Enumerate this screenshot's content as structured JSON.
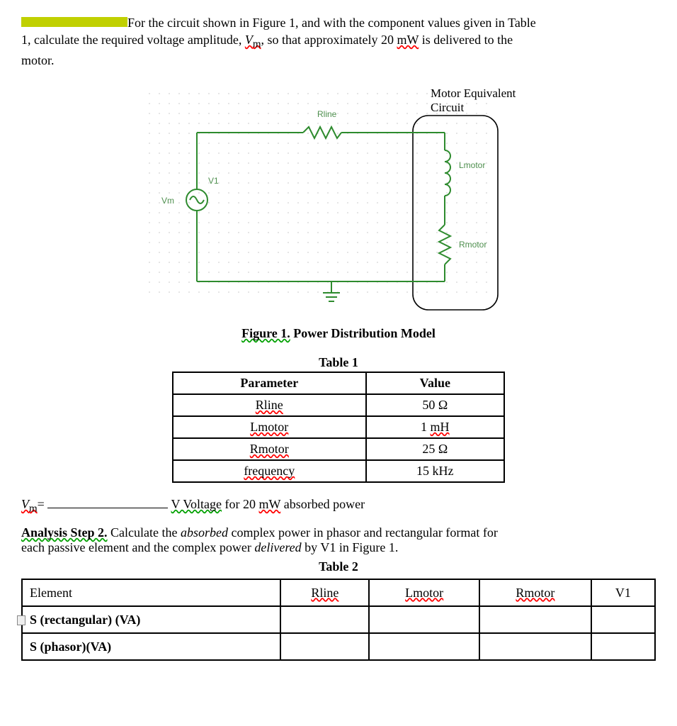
{
  "problem": {
    "lead1a": "For the circuit shown in Figure 1, and with the component values given in Table",
    "lead1b": "1, calculate the required voltage amplitude, ",
    "vm_label": "V",
    "vm_sub": "m",
    "lead1c": ", so that approximately 20 ",
    "mW": "mW",
    "lead1d": " is delivered to the",
    "lead1e": "motor."
  },
  "figure": {
    "title_motor": "Motor Equivalent",
    "title_circuit": "Circuit",
    "rline": "Rline",
    "vm": "Vm",
    "v1": "V1",
    "lmotor": "Lmotor",
    "rmotor": "Rmotor",
    "caption_prefix": "Figure 1.",
    "caption_text": " Power Distribution Model"
  },
  "table1": {
    "caption": "Table 1",
    "headers": [
      "Parameter",
      "Value"
    ],
    "rows": [
      {
        "param": "Rline",
        "value": "50 Ω"
      },
      {
        "param": "Lmotor",
        "value": "1 mH",
        "value_wavy": "mH"
      },
      {
        "param": "Rmotor",
        "value": "25 Ω"
      },
      {
        "param": "frequency",
        "value": "15 kHz"
      }
    ]
  },
  "answer_line": {
    "vm_eq": "V",
    "vm_sub": "m",
    "eq": "=",
    "unit": "V  Voltage",
    "rest": " for 20 ",
    "mW": "mW",
    "rest2": " absorbed power"
  },
  "step2": {
    "label": "Analysis Step 2.",
    "text1": "  Calculate the ",
    "absorbed": "absorbed",
    "text2": " complex power in phasor and rectangular format for",
    "text3": "each passive element and the complex power ",
    "delivered": "delivered",
    "text4": " by V1 in Figure 1."
  },
  "table2": {
    "caption": "Table 2",
    "headers": [
      "Element",
      "Rline",
      "Lmotor",
      "Rmotor",
      "V1"
    ],
    "rows": [
      {
        "label": "S (rectangular) (VA)"
      },
      {
        "label": "S (phasor)(VA)"
      }
    ]
  }
}
